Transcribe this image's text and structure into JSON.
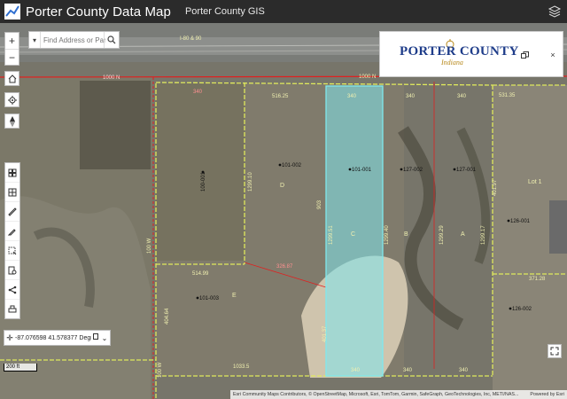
{
  "header": {
    "title": "Porter County Data Map",
    "subtitle": "Porter County GIS",
    "logo_icon": "chart-wave-logo",
    "layers_icon": "layers-icon"
  },
  "search": {
    "placeholder": "Find Address or Parc...",
    "dropdown_icon": "chevron-down-icon",
    "button_icon": "search-icon"
  },
  "zoom": {
    "in_label": "+",
    "out_label": "−"
  },
  "nav_icons": [
    "home-icon",
    "locate-icon",
    "compass-icon"
  ],
  "tools": [
    "basemap-gallery-icon",
    "layer-list-icon",
    "measure-icon",
    "draw-icon",
    "select-icon",
    "query-icon",
    "share-icon",
    "print-icon"
  ],
  "coordinates": {
    "value": "-87.076598 41.578377 Degr..."
  },
  "scale": "200 ft",
  "attribution": {
    "text": "Esri Community Maps Contributors, © OpenStreetMap, Microsoft, Esri, TomTom, Garmin, SafeGraph, GeoTechnologies, Inc, METI/NAS...",
    "powered": "Powered by Esri"
  },
  "widget": {
    "brand": "PORTER COUNTY",
    "script": "Indiana",
    "restore_icon": "restore-window-icon",
    "close_label": "×"
  },
  "map_labels": {
    "highway": "I-80 & 90",
    "road_north": "1000 N",
    "road_north_b": "1000 N",
    "road_west": "100 W",
    "road_west_b": "100 W",
    "parcels": [
      "101-001",
      "101-002",
      "100-001",
      "127-002",
      "127-001",
      "126-001",
      "126-002",
      "101-003",
      "D",
      "C",
      "B",
      "A",
      "E",
      "Lot 1"
    ],
    "dims": [
      "340",
      "516.25",
      "340",
      "340",
      "531.35",
      "340",
      "326.87",
      "340",
      "340",
      "340",
      "514.99",
      "1033.5",
      "1299.40",
      "1299.51",
      "1299.29",
      "1299.17",
      "1299.10",
      "903",
      "401.37",
      "404.64",
      "401.97",
      "371.28"
    ]
  },
  "colors": {
    "topbar": "#2b2b2b",
    "selected_parcel": "#7fe8ee",
    "parcel_line": "#dfe95c",
    "road_line": "#e02020"
  }
}
